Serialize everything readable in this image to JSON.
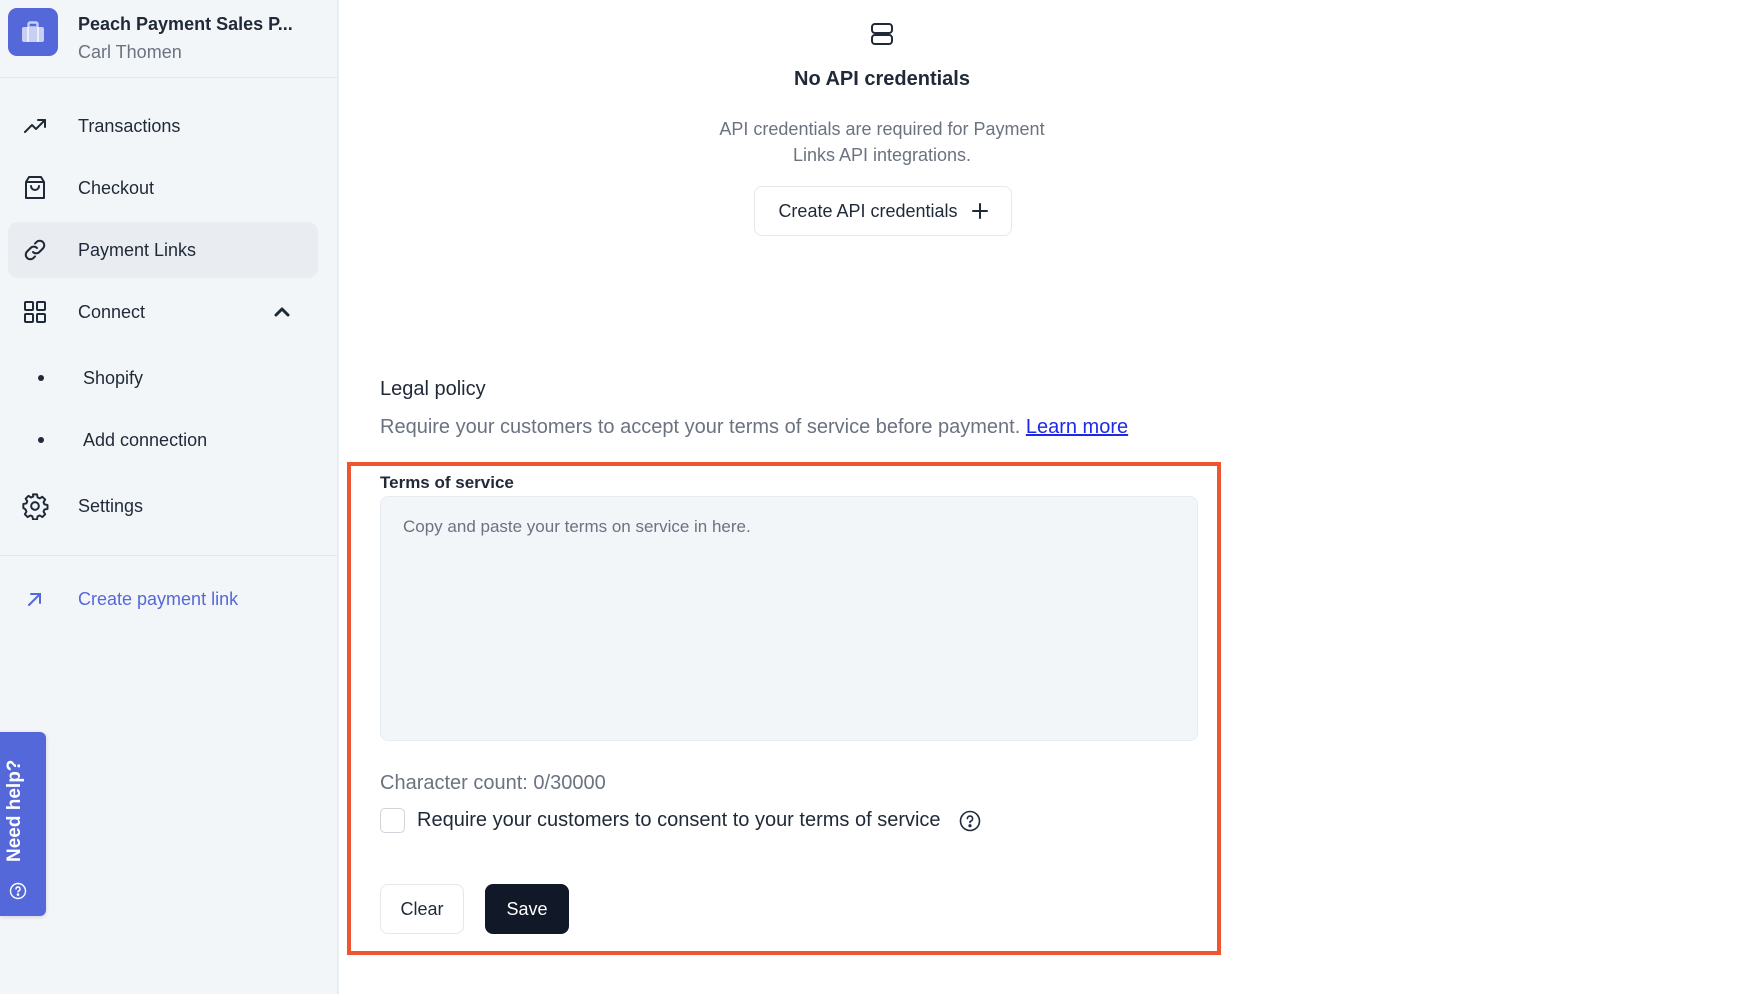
{
  "sidebar": {
    "org_name": "Peach Payment Sales P...",
    "user_name": "Carl Thomen",
    "nav": [
      {
        "label": "Transactions",
        "icon": "trending-up-icon"
      },
      {
        "label": "Checkout",
        "icon": "shopping-bag-icon"
      },
      {
        "label": "Payment Links",
        "icon": "link-icon",
        "active": true
      },
      {
        "label": "Connect",
        "icon": "grid-icon",
        "expanded": true
      }
    ],
    "connect_children": [
      {
        "label": "Shopify"
      },
      {
        "label": "Add connection"
      }
    ],
    "settings_label": "Settings",
    "create_link_label": "Create payment link",
    "help_label": "Need help?"
  },
  "api": {
    "title": "No API credentials",
    "description": "API credentials are required for Payment Links API integrations.",
    "button_label": "Create API credentials"
  },
  "legal": {
    "title": "Legal policy",
    "description": "Require your customers to accept your terms of service before payment.",
    "learn_more": "Learn more",
    "tos_label": "Terms of service",
    "tos_value": "",
    "tos_placeholder": "Copy and paste your terms on service in here.",
    "char_count": "Character count: 0/30000",
    "consent_label": "Require your customers to consent to your terms of service",
    "consent_checked": false,
    "clear_label": "Clear",
    "save_label": "Save"
  },
  "colors": {
    "accent": "#5468d9",
    "highlight": "#ee5530",
    "primary_button": "#111827"
  }
}
